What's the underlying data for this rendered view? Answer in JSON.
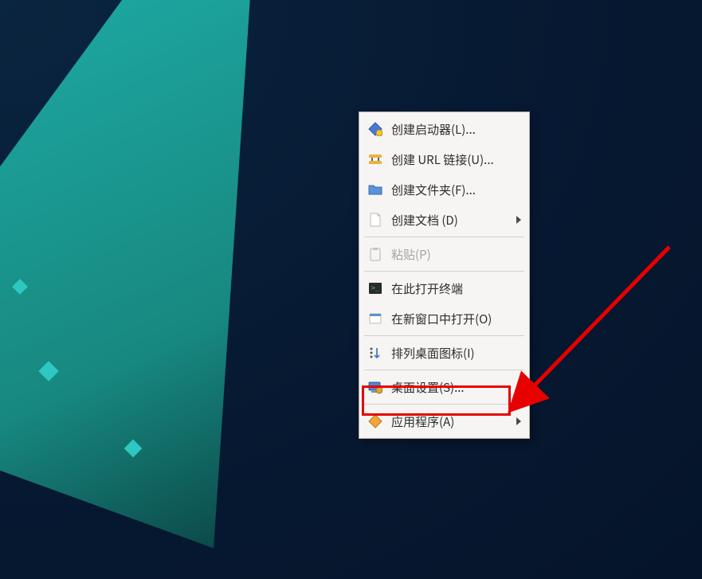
{
  "menu": {
    "items": [
      {
        "label": "创建启动器(L)..."
      },
      {
        "label": "创建 URL 链接(U)..."
      },
      {
        "label": "创建文件夹(F)..."
      },
      {
        "label": "创建文档 (D)"
      },
      {
        "label": "粘贴(P)"
      },
      {
        "label": "在此打开终端"
      },
      {
        "label": "在新窗口中打开(O)"
      },
      {
        "label": "排列桌面图标(I)"
      },
      {
        "label": "桌面设置(S)..."
      },
      {
        "label": "应用程序(A)"
      }
    ]
  },
  "annotation": {
    "highlight_target": "desktop-settings"
  }
}
